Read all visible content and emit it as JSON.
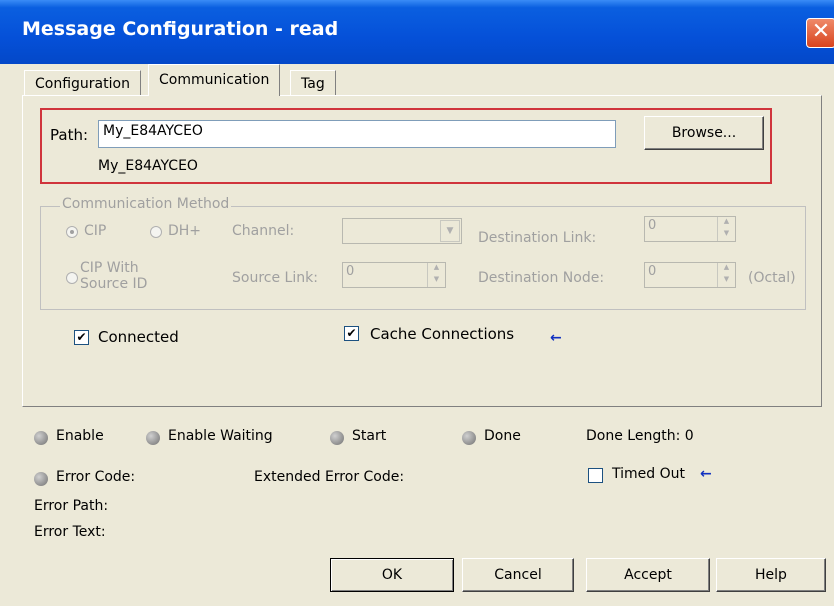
{
  "window": {
    "title": "Message Configuration - read",
    "close_symbol": "✕"
  },
  "tabs": [
    "Configuration",
    "Communication",
    "Tag"
  ],
  "path": {
    "label": "Path:",
    "value": "My_E84AYCEO",
    "resolved": "My_E84AYCEO",
    "browse_label": "Browse..."
  },
  "comm_method": {
    "group_label": "Communication Method",
    "cip_label": "CIP",
    "dhplus_label": "DH+",
    "channel_label": "Channel:",
    "cip_source_line1": "CIP With",
    "cip_source_line2": "Source ID",
    "source_link_label": "Source Link:",
    "source_link_value": "0",
    "dest_link_label": "Destination Link:",
    "dest_link_value": "0",
    "dest_node_label": "Destination Node:",
    "dest_node_value": "0",
    "octal_label": "(Octal)"
  },
  "options": {
    "connected_label": "Connected",
    "connected_checked": true,
    "cache_label": "Cache Connections",
    "cache_checked": true,
    "check_mark": "✔",
    "arrow_symbol": "←"
  },
  "status": {
    "enable": "Enable",
    "enable_waiting": "Enable Waiting",
    "start": "Start",
    "done": "Done",
    "done_length": "Done Length: 0",
    "error_code": "Error Code:",
    "extended_error_code": "Extended Error Code:",
    "timed_out": "Timed Out",
    "error_path": "Error Path:",
    "error_text": "Error Text:"
  },
  "buttons": {
    "ok": "OK",
    "cancel": "Cancel",
    "accept": "Accept",
    "help": "Help"
  },
  "colors": {
    "highlight_box": "#d0343c",
    "titlebar": "#0550d8",
    "dialog_bg": "#ece9d8",
    "arrow": "#1030c0"
  }
}
